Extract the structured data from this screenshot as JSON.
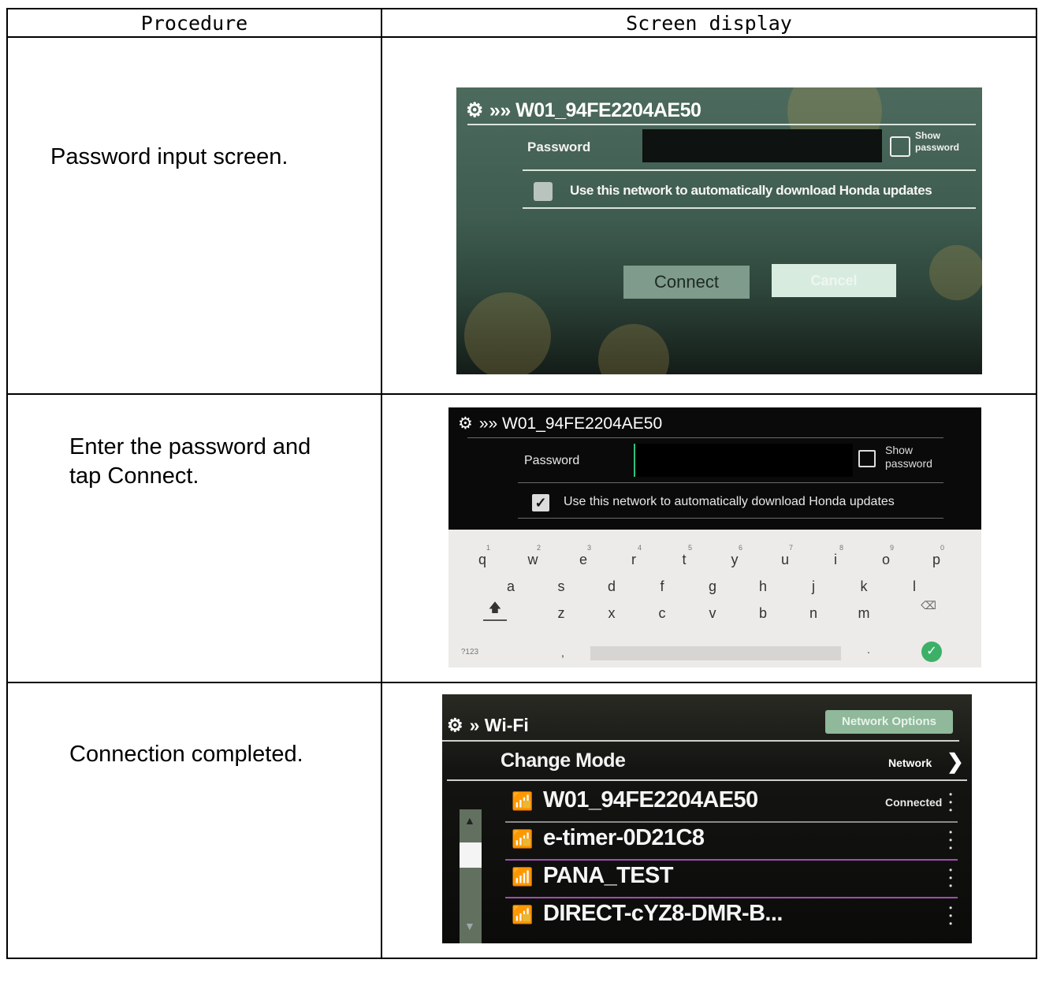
{
  "table": {
    "headers": [
      "Procedure",
      "Screen display"
    ],
    "rows": [
      {
        "procedure": "Password input screen."
      },
      {
        "procedure_lines": [
          "Enter the password and",
          "tap Connect."
        ]
      },
      {
        "procedure": "Connection completed."
      }
    ]
  },
  "screen1": {
    "title": "»» W01_94FE2204AE50",
    "password_label": "Password",
    "show_password": [
      "Show",
      "password"
    ],
    "auto_download": "Use this network to automatically download Honda updates",
    "connect_label": "Connect",
    "cancel_label": "Cancel"
  },
  "screen2": {
    "title": "»» W01_94FE2204AE50",
    "password_label": "Password",
    "show_password": [
      "Show",
      "password"
    ],
    "auto_download": "Use this network to automatically download Honda updates",
    "keyboard": {
      "row1": [
        [
          "q",
          "1"
        ],
        [
          "w",
          "2"
        ],
        [
          "e",
          "3"
        ],
        [
          "r",
          "4"
        ],
        [
          "t",
          "5"
        ],
        [
          "y",
          "6"
        ],
        [
          "u",
          "7"
        ],
        [
          "i",
          "8"
        ],
        [
          "o",
          "9"
        ],
        [
          "p",
          "0"
        ]
      ],
      "row2": [
        "a",
        "s",
        "d",
        "f",
        "g",
        "h",
        "j",
        "k",
        "l"
      ],
      "row3": [
        "z",
        "x",
        "c",
        "v",
        "b",
        "n",
        "m"
      ],
      "symbols_label": "?123",
      "comma": ",",
      "period": "."
    }
  },
  "screen3": {
    "title": "» Wi-Fi",
    "network_options": "Network Options",
    "change_mode": "Change Mode",
    "mode_value": "Network",
    "networks": [
      {
        "ssid": "W01_94FE2204AE50",
        "status": "Connected",
        "locked": true
      },
      {
        "ssid": "e-timer-0D21C8",
        "status": "",
        "locked": true
      },
      {
        "ssid": "PANA_TEST",
        "status": "",
        "locked": false
      },
      {
        "ssid": "DIRECT-cYZ8-DMR-B...",
        "status": "",
        "locked": true
      }
    ]
  },
  "colors": {
    "accent_green": "#2ec27e",
    "lock_yellow": "#e9b734",
    "row_separator": "#a04fb0"
  }
}
